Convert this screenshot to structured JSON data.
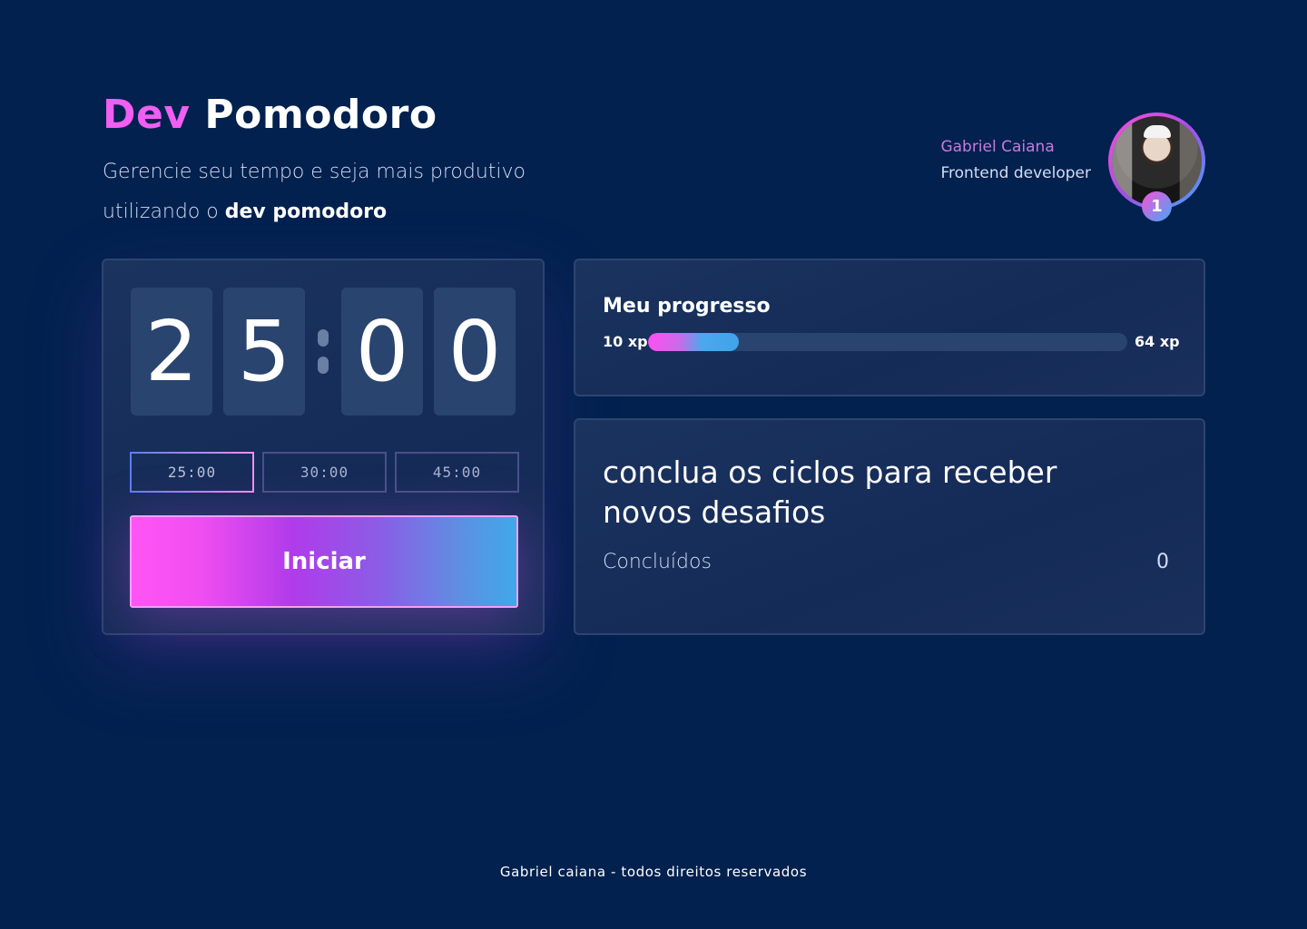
{
  "header": {
    "title_accent": "Dev",
    "title_rest": "Pomodoro",
    "subtitle_line1": "Gerencie seu tempo e seja mais produtivo",
    "subtitle_prefix": "utilizando o ",
    "subtitle_bold": "dev pomodoro"
  },
  "profile": {
    "name": "Gabriel Caiana",
    "role": "Frontend developer",
    "level": "1"
  },
  "timer": {
    "digits": [
      "2",
      "5",
      "0",
      "0"
    ],
    "presets": [
      "25:00",
      "30:00",
      "45:00"
    ],
    "active_preset": "25:00",
    "start_label": "Iniciar"
  },
  "progress": {
    "title": "Meu progresso",
    "min_label": "10 xp",
    "max_label": "64 xp",
    "fill_fraction": 0.19
  },
  "challenge": {
    "title": "conclua os ciclos para receber novos desafios",
    "completed_label": "Concluídos",
    "completed_count": "0"
  },
  "footer": {
    "text": "Gabriel caiana - todos direitos reservados"
  },
  "colors": {
    "background": "#02214f",
    "accent_pink": "#f05ef2",
    "accent_blue": "#3fa9f5",
    "card": "#172e5a"
  }
}
